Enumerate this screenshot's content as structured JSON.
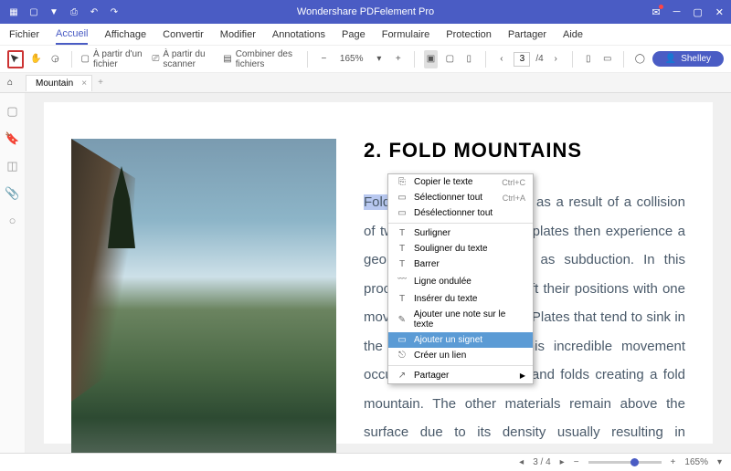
{
  "title": "Wondershare PDFelement Pro",
  "menu": [
    "Fichier",
    "Accueil",
    "Affichage",
    "Convertir",
    "Modifier",
    "Annotations",
    "Page",
    "Formulaire",
    "Protection",
    "Partager",
    "Aide"
  ],
  "menu_active": 1,
  "toolbar": {
    "from_file": "À partir d'un fichier",
    "from_scanner": "À partir du scanner",
    "combine": "Combiner des fichiers",
    "zoom": "165%",
    "page_cur": "3",
    "page_total": "/4",
    "user": "Shelley"
  },
  "tab": {
    "name": "Mountain"
  },
  "doc": {
    "heading": "2. FOLD MOUNTAINS",
    "hilite": "Fold mountains",
    "body": " are formed as a result of a collision of two tectonic plates. The plates then experience a geological process known as subduction. In this process, tectonic plates shift their positions with one moving below one another. Plates that tend to sink in the mantle because of this incredible movement occurs the plate crumbles and folds creating a fold mountain. The other materials remain above the surface due to its density usually resulting in plateaus or hills."
  },
  "ctx": [
    {
      "ic": "⎘",
      "label": "Copier le texte",
      "sc": "Ctrl+C"
    },
    {
      "ic": "▭",
      "label": "Sélectionner tout",
      "sc": "Ctrl+A"
    },
    {
      "ic": "▭",
      "label": "Désélectionner tout"
    },
    {
      "sep": true
    },
    {
      "ic": "T",
      "label": "Surligner"
    },
    {
      "ic": "T",
      "label": "Souligner du texte"
    },
    {
      "ic": "T",
      "label": "Barrer"
    },
    {
      "ic": "﹋",
      "label": "Ligne ondulée"
    },
    {
      "ic": "T",
      "label": "Insérer du texte"
    },
    {
      "ic": "✎",
      "label": "Ajouter une note sur le texte"
    },
    {
      "ic": "▭",
      "label": "Ajouter un signet",
      "hov": true
    },
    {
      "ic": "⎋",
      "label": "Créer un lien"
    },
    {
      "sep": true
    },
    {
      "ic": "↗",
      "label": "Partager",
      "arrow": true
    }
  ],
  "status": {
    "page": "3 / 4",
    "zoom": "165%"
  }
}
